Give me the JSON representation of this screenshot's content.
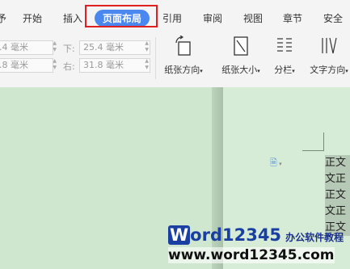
{
  "tabs": [
    {
      "label": "予"
    },
    {
      "label": "开始"
    },
    {
      "label": "插入"
    },
    {
      "label": "页面布局"
    },
    {
      "label": "引用"
    },
    {
      "label": "审阅"
    },
    {
      "label": "视图"
    },
    {
      "label": "章节"
    },
    {
      "label": "安全"
    }
  ],
  "margins": {
    "top_left_value": ".4 毫米",
    "bottom_left_value": ".8 毫米",
    "bottom_label": "下:",
    "bottom_value": "25.4 毫米",
    "right_label": "右:",
    "right_value": "31.8 毫米"
  },
  "tools": {
    "orientation": "纸张方向",
    "size": "纸张大小",
    "columns": "分栏",
    "text_direction": "文字方向"
  },
  "document": {
    "lines": [
      "正文",
      "文正",
      "正文",
      "文正",
      "正文"
    ]
  },
  "watermark": {
    "brand_w": "W",
    "brand_rest": "ord12345",
    "tagline": "办公软件教程",
    "url": "www.word12345.com"
  },
  "colors": {
    "active_tab": "#4a88f0",
    "highlight_box": "#e02020",
    "page_bg": "#d6ecd6"
  }
}
